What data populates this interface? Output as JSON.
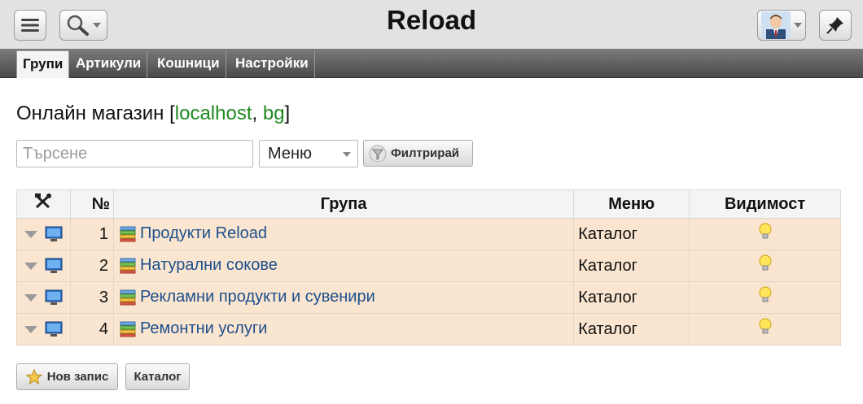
{
  "app": {
    "title": "Reload"
  },
  "tabs": [
    {
      "label": "Групи",
      "active": true
    },
    {
      "label": "Артикули",
      "active": false
    },
    {
      "label": "Кошници",
      "active": false
    },
    {
      "label": "Настройки",
      "active": false
    }
  ],
  "heading": {
    "prefix": "Онлайн магазин [",
    "host": "localhost",
    "sep": ", ",
    "lang": "bg",
    "suffix": "]"
  },
  "filter": {
    "search_placeholder": "Търсене",
    "select_value": "Меню",
    "filter_button": "Филтрирай"
  },
  "table": {
    "columns": {
      "tools": "",
      "num": "№",
      "group": "Група",
      "menu": "Меню",
      "visibility": "Видимост"
    },
    "rows": [
      {
        "num": "1",
        "group": "Продукти Reload",
        "menu": "Каталог"
      },
      {
        "num": "2",
        "group": "Натурални сокове",
        "menu": "Каталог"
      },
      {
        "num": "3",
        "group": "Рекламни продукти и сувенири",
        "menu": "Каталог"
      },
      {
        "num": "4",
        "group": "Ремонтни услуги",
        "menu": "Каталог"
      }
    ]
  },
  "actions": {
    "new_record": "Нов запис",
    "catalog": "Каталог"
  },
  "icons": {
    "menu": "hamburger-icon",
    "search": "magnifier-icon",
    "user": "avatar-icon",
    "pin": "pin-icon",
    "tools": "tools-icon",
    "row_toggle": "triangle-down-icon",
    "row_view": "monitor-icon",
    "group": "stack-icon",
    "visibility": "lightbulb-icon",
    "filter": "funnel-icon",
    "new": "star-icon"
  },
  "colors": {
    "link": "#1c4f8c",
    "green": "#1f8a1f",
    "row_bg": "#fae6d0"
  }
}
